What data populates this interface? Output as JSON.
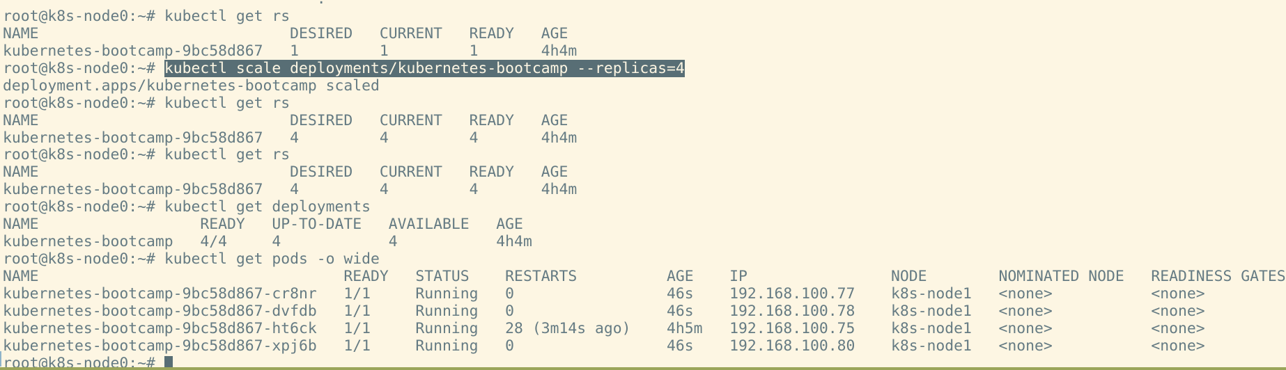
{
  "terminal": {
    "lines": [
      {
        "prefix": "                                   .",
        "command": "",
        "highlighted": false
      },
      {
        "prefix": "root@k8s-node0:~# ",
        "command": "kubectl get rs",
        "highlighted": false
      },
      {
        "prefix": "NAME                            DESIRED   CURRENT   READY   AGE",
        "command": "",
        "highlighted": false
      },
      {
        "prefix": "kubernetes-bootcamp-9bc58d867   1         1         1       4h4m",
        "command": "",
        "highlighted": false
      },
      {
        "prefix": "root@k8s-node0:~# ",
        "command": "kubectl scale deployments/kubernetes-bootcamp --replicas=4",
        "highlighted": true
      },
      {
        "prefix": "deployment.apps/kubernetes-bootcamp scaled",
        "command": "",
        "highlighted": false
      },
      {
        "prefix": "root@k8s-node0:~# ",
        "command": "kubectl get rs",
        "highlighted": false
      },
      {
        "prefix": "NAME                            DESIRED   CURRENT   READY   AGE",
        "command": "",
        "highlighted": false
      },
      {
        "prefix": "kubernetes-bootcamp-9bc58d867   4         4         4       4h4m",
        "command": "",
        "highlighted": false
      },
      {
        "prefix": "root@k8s-node0:~# ",
        "command": "kubectl get rs",
        "highlighted": false
      },
      {
        "prefix": "NAME                            DESIRED   CURRENT   READY   AGE",
        "command": "",
        "highlighted": false
      },
      {
        "prefix": "kubernetes-bootcamp-9bc58d867   4         4         4       4h4m",
        "command": "",
        "highlighted": false
      },
      {
        "prefix": "root@k8s-node0:~# ",
        "command": "kubectl get deployments",
        "highlighted": false
      },
      {
        "prefix": "NAME                  READY   UP-TO-DATE   AVAILABLE   AGE",
        "command": "",
        "highlighted": false
      },
      {
        "prefix": "kubernetes-bootcamp   4/4     4            4           4h4m",
        "command": "",
        "highlighted": false
      },
      {
        "prefix": "root@k8s-node0:~# ",
        "command": "kubectl get pods -o wide",
        "highlighted": false
      },
      {
        "prefix": "NAME                                  READY   STATUS    RESTARTS          AGE    IP                NODE        NOMINATED NODE   READINESS GATES",
        "command": "",
        "highlighted": false
      },
      {
        "prefix": "kubernetes-bootcamp-9bc58d867-cr8nr   1/1     Running   0                 46s    192.168.100.77    k8s-node1   <none>           <none>",
        "command": "",
        "highlighted": false
      },
      {
        "prefix": "kubernetes-bootcamp-9bc58d867-dvfdb   1/1     Running   0                 46s    192.168.100.78    k8s-node1   <none>           <none>",
        "command": "",
        "highlighted": false
      },
      {
        "prefix": "kubernetes-bootcamp-9bc58d867-ht6ck   1/1     Running   28 (3m14s ago)    4h5m   192.168.100.75    k8s-node1   <none>           <none>",
        "command": "",
        "highlighted": false
      },
      {
        "prefix": "kubernetes-bootcamp-9bc58d867-xpj6b   1/1     Running   0                 46s    192.168.100.80    k8s-node1   <none>           <none>",
        "command": "",
        "highlighted": false
      }
    ],
    "current_prompt": "root@k8s-node0:~# "
  },
  "colors": {
    "background": "#fdf6e3",
    "foreground": "#657b83",
    "selection_background": "#586e75",
    "selection_foreground": "#fdf6e3",
    "cursor": "#586e75",
    "bottom_border": "#9ba55a"
  }
}
